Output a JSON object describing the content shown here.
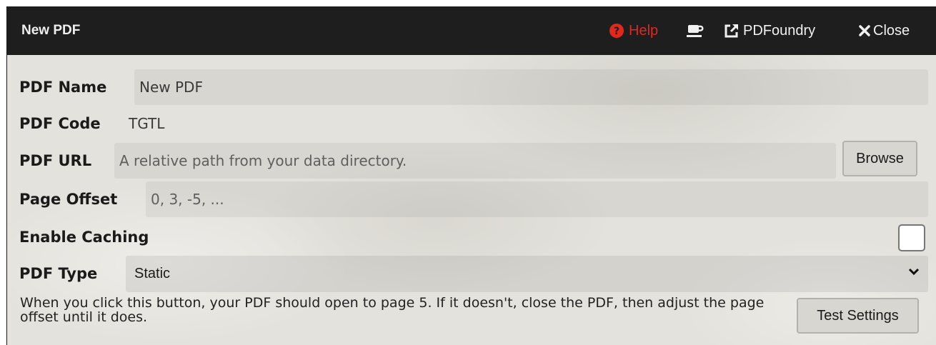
{
  "window": {
    "title": "New PDF",
    "header": {
      "help_label": "Help",
      "help_icon": "question-circle-icon",
      "coffee_icon": "coffee-icon",
      "foundry_label": "PDFoundry",
      "foundry_icon": "external-link-icon",
      "close_label": "Close",
      "close_icon": "close-icon"
    }
  },
  "form": {
    "pdf_name": {
      "label": "PDF Name",
      "value": "New PDF"
    },
    "pdf_code": {
      "label": "PDF Code",
      "value": "TGTL"
    },
    "pdf_url": {
      "label": "PDF URL",
      "placeholder": "A relative path from your data directory.",
      "browse_label": "Browse"
    },
    "page_offset": {
      "label": "Page Offset",
      "placeholder": "0, 3, -5, ..."
    },
    "enable_caching": {
      "label": "Enable Caching",
      "checked": false
    },
    "pdf_type": {
      "label": "PDF Type",
      "value": "Static"
    },
    "test": {
      "note": "When you click this button, your PDF should open to page 5. If it doesn't, close the PDF, then adjust the page offset until it does.",
      "button_label": "Test Settings"
    }
  },
  "colors": {
    "titlebar": "#1e1e1e",
    "help": "#e0281e",
    "background": "#e4e2dc"
  }
}
